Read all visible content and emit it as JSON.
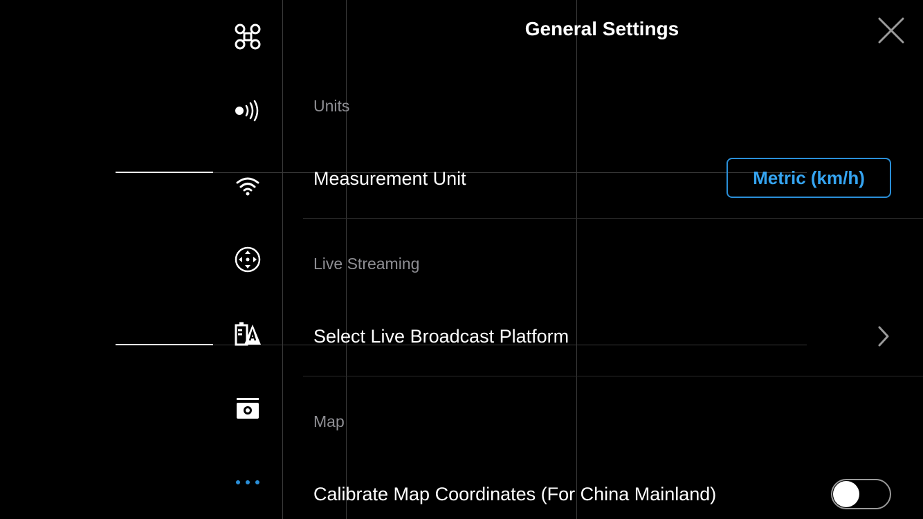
{
  "header": {
    "title": "General Settings"
  },
  "sidebar": {
    "items": [
      {
        "icon": "drone-icon"
      },
      {
        "icon": "signal-icon"
      },
      {
        "icon": "wifi-icon"
      },
      {
        "icon": "gimbal-icon"
      },
      {
        "icon": "battery-warning-icon"
      },
      {
        "icon": "camera-icon"
      },
      {
        "icon": "more-icon",
        "active": true
      }
    ]
  },
  "settings": {
    "units_section": "Units",
    "measurement_label": "Measurement Unit",
    "measurement_value": "Metric (km/h)",
    "live_section": "Live Streaming",
    "live_label": "Select Live Broadcast Platform",
    "map_section": "Map",
    "map_label": "Calibrate Map Coordinates (For China Mainland)",
    "map_toggle_on": false
  },
  "colors": {
    "accent": "#35a4f1",
    "background": "#000000"
  }
}
